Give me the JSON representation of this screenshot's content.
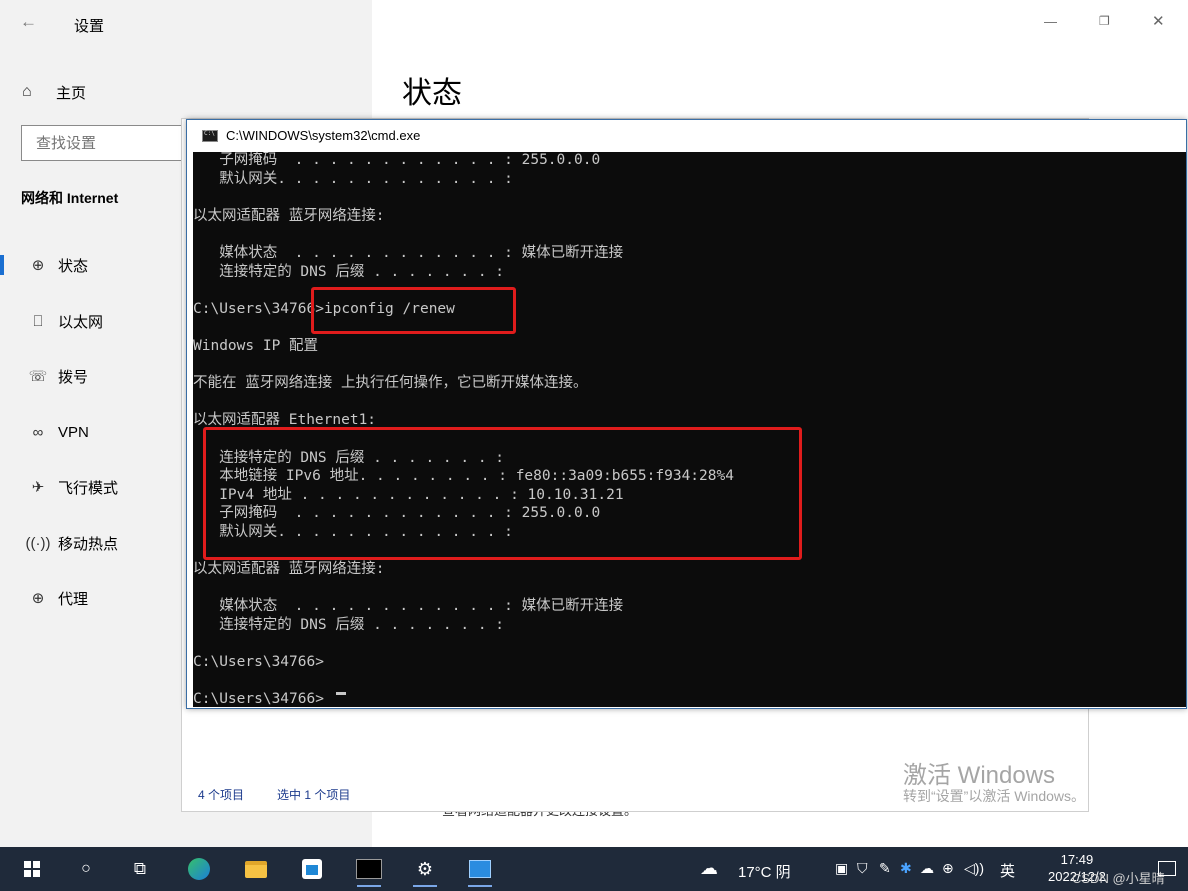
{
  "settings": {
    "title": "设置",
    "back_icon": "←",
    "home_label": "主页",
    "search_placeholder": "查找设置",
    "section_title": "网络和 Internet",
    "nav": [
      {
        "label": "状态",
        "icon": "status-icon"
      },
      {
        "label": "以太网",
        "icon": "ethernet-icon"
      },
      {
        "label": "拨号",
        "icon": "dialup-icon"
      },
      {
        "label": "VPN",
        "icon": "vpn-icon"
      },
      {
        "label": "飞行模式",
        "icon": "airplane-icon"
      },
      {
        "label": "移动热点",
        "icon": "hotspot-icon"
      },
      {
        "label": "代理",
        "icon": "proxy-icon"
      }
    ],
    "page_title": "状态",
    "bottom_text": "查看网络适配器并更改连接设置。"
  },
  "explorer": {
    "item_count": "4 个项目",
    "selected": "选中 1 个项目"
  },
  "cmd": {
    "title": "C:\\WINDOWS\\system32\\cmd.exe",
    "lines": [
      "   子网掩码  . . . . . . . . . . . . : 255.0.0.0",
      "   默认网关. . . . . . . . . . . . . :",
      "",
      "以太网适配器 蓝牙网络连接:",
      "",
      "   媒体状态  . . . . . . . . . . . . : 媒体已断开连接",
      "   连接特定的 DNS 后缀 . . . . . . . :",
      "",
      "C:\\Users\\34766>ipconfig /renew",
      "",
      "Windows IP 配置",
      "",
      "不能在 蓝牙网络连接 上执行任何操作，它已断开媒体连接。",
      "",
      "以太网适配器 Ethernet1:",
      "",
      "   连接特定的 DNS 后缀 . . . . . . . :",
      "   本地链接 IPv6 地址. . . . . . . . : fe80::3a09:b655:f934:28%4",
      "   IPv4 地址 . . . . . . . . . . . . : 10.10.31.21",
      "   子网掩码  . . . . . . . . . . . . : 255.0.0.0",
      "   默认网关. . . . . . . . . . . . . :",
      "",
      "以太网适配器 蓝牙网络连接:",
      "",
      "   媒体状态  . . . . . . . . . . . . : 媒体已断开连接",
      "   连接特定的 DNS 后缀 . . . . . . . :",
      "",
      "C:\\Users\\34766>",
      "",
      "C:\\Users\\34766>"
    ]
  },
  "watermark": {
    "line1": "激活 Windows",
    "line2": "转到“设置”以激活 Windows。"
  },
  "taskbar": {
    "weather": "17°C 阴",
    "ime": "英",
    "time": "17:49",
    "date": "2022/12/2",
    "credit": "CSDN @小星晴"
  },
  "colors": {
    "annotation": "#e01c1c",
    "accent": "#1a6fd1",
    "cmd_bg": "#0c0c0c",
    "taskbar_bg": "#1f2a3a"
  }
}
